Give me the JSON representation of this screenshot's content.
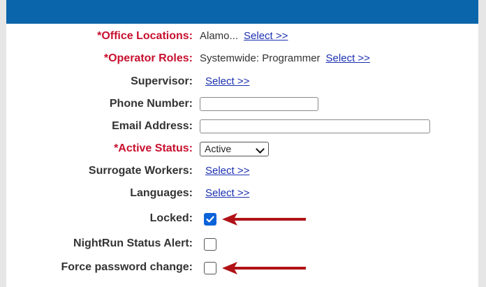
{
  "form": {
    "office_locations": {
      "label": "*Office Locations:",
      "value": "Alamo...",
      "select_link": "Select >>"
    },
    "operator_roles": {
      "label": "*Operator Roles:",
      "value": "Systemwide: Programmer",
      "select_link": "Select >>"
    },
    "supervisor": {
      "label": "Supervisor:",
      "select_link": "Select >>"
    },
    "phone_number": {
      "label": "Phone Number:",
      "value": ""
    },
    "email_address": {
      "label": "Email Address:",
      "value": ""
    },
    "active_status": {
      "label": "*Active Status:",
      "selected": "Active"
    },
    "surrogate_workers": {
      "label": "Surrogate Workers:",
      "select_link": "Select >>"
    },
    "languages": {
      "label": "Languages:",
      "select_link": "Select >>"
    },
    "locked": {
      "label": "Locked:",
      "checked": true
    },
    "nightrun_status_alert": {
      "label": "NightRun Status Alert:",
      "checked": false
    },
    "force_password_change": {
      "label": "Force password change:",
      "checked": false
    }
  },
  "colors": {
    "header_bar": "#0b65aa",
    "required_label": "#c8102e",
    "link": "#1a2fb0",
    "checkbox_checked": "#0a63d8",
    "annotation_arrow": "#b01217"
  },
  "annotations": {
    "arrow_icon": "left-arrow-icon"
  }
}
